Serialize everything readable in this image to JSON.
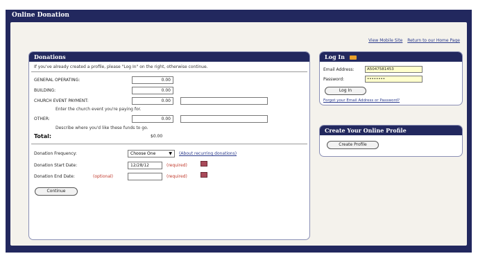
{
  "title": "Online Donation",
  "top_links": {
    "mobile": "View Mobile Site",
    "home": "Return to our Home Page"
  },
  "donations": {
    "header": "Donations",
    "intro": "If you've already created a profile, please \"Log In\" on the right, otherwise continue.",
    "general_label": "GENERAL OPERATING:",
    "general_value": "0.00",
    "building_label": "BUILDING:",
    "building_value": "0.00",
    "church_label": "CHURCH EVENT PAYMENT:",
    "church_value": "0.00",
    "church_hint": "Enter the church event you're paying for.",
    "other_label": "OTHER:",
    "other_value": "0.00",
    "other_hint": "Describe where you'd like these funds to go.",
    "total_label": "Total:",
    "total_value": "$0.00",
    "frequency_label": "Donation Frequency:",
    "frequency_selected": "Choose One",
    "frequency_link": "(About recurring donations)",
    "start_label": "Donation Start Date:",
    "start_value": "12/28/12",
    "start_required": "(required)",
    "end_label": "Donation End Date:",
    "end_optional": "(optional)",
    "end_required": "(required)",
    "continue_label": "Continue"
  },
  "login": {
    "header": "Log In",
    "email_label": "Email Address:",
    "email_value": "A5047581453",
    "password_label": "Password:",
    "password_value": "••••••••",
    "button": "Log In",
    "forgot": "Forgot your Email Address or Password?"
  },
  "profile": {
    "header": "Create Your Online Profile",
    "button": "Create Profile"
  }
}
